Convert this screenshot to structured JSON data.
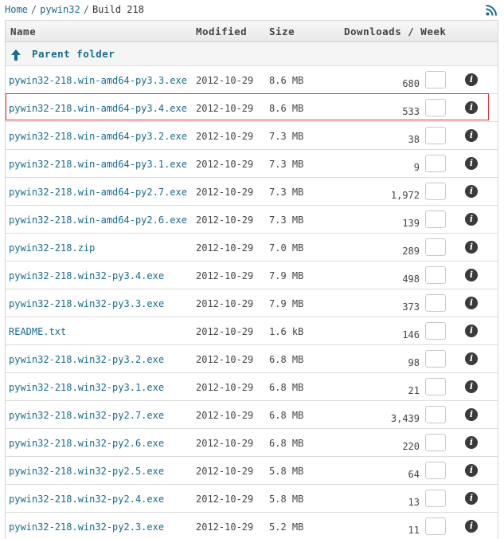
{
  "breadcrumb": {
    "home": "Home",
    "sep1": "/",
    "project": "pywin32",
    "sep2": "/",
    "current": "Build 218"
  },
  "icons": {
    "rss": "rss-icon",
    "up_arrow": "arrow-up-icon",
    "info": "info-icon"
  },
  "colors": {
    "link": "#1a6a8e",
    "highlight": "#d9343a"
  },
  "table": {
    "headers": {
      "name": "Name",
      "modified": "Modified",
      "size": "Size",
      "downloads": "Downloads / Week"
    },
    "parent_label": "Parent folder",
    "info_glyph": "i",
    "rows": [
      {
        "name": "pywin32-218.win-amd64-py3.3.exe",
        "modified": "2012-10-29",
        "size": "8.6 MB",
        "downloads": "680"
      },
      {
        "name": "pywin32-218.win-amd64-py3.4.exe",
        "modified": "2012-10-29",
        "size": "8.6 MB",
        "downloads": "533"
      },
      {
        "name": "pywin32-218.win-amd64-py3.2.exe",
        "modified": "2012-10-29",
        "size": "7.3 MB",
        "downloads": "38"
      },
      {
        "name": "pywin32-218.win-amd64-py3.1.exe",
        "modified": "2012-10-29",
        "size": "7.3 MB",
        "downloads": "9"
      },
      {
        "name": "pywin32-218.win-amd64-py2.7.exe",
        "modified": "2012-10-29",
        "size": "7.3 MB",
        "downloads": "1,972"
      },
      {
        "name": "pywin32-218.win-amd64-py2.6.exe",
        "modified": "2012-10-29",
        "size": "7.3 MB",
        "downloads": "139"
      },
      {
        "name": "pywin32-218.zip",
        "modified": "2012-10-29",
        "size": "7.0 MB",
        "downloads": "289"
      },
      {
        "name": "pywin32-218.win32-py3.4.exe",
        "modified": "2012-10-29",
        "size": "7.9 MB",
        "downloads": "498"
      },
      {
        "name": "pywin32-218.win32-py3.3.exe",
        "modified": "2012-10-29",
        "size": "7.9 MB",
        "downloads": "373"
      },
      {
        "name": "README.txt",
        "modified": "2012-10-29",
        "size": "1.6 kB",
        "downloads": "146"
      },
      {
        "name": "pywin32-218.win32-py3.2.exe",
        "modified": "2012-10-29",
        "size": "6.8 MB",
        "downloads": "98"
      },
      {
        "name": "pywin32-218.win32-py3.1.exe",
        "modified": "2012-10-29",
        "size": "6.8 MB",
        "downloads": "21"
      },
      {
        "name": "pywin32-218.win32-py2.7.exe",
        "modified": "2012-10-29",
        "size": "6.8 MB",
        "downloads": "3,439"
      },
      {
        "name": "pywin32-218.win32-py2.6.exe",
        "modified": "2012-10-29",
        "size": "6.8 MB",
        "downloads": "220"
      },
      {
        "name": "pywin32-218.win32-py2.5.exe",
        "modified": "2012-10-29",
        "size": "5.8 MB",
        "downloads": "64"
      },
      {
        "name": "pywin32-218.win32-py2.4.exe",
        "modified": "2012-10-29",
        "size": "5.8 MB",
        "downloads": "13"
      },
      {
        "name": "pywin32-218.win32-py2.3.exe",
        "modified": "2012-10-29",
        "size": "5.2 MB",
        "downloads": "11"
      }
    ]
  }
}
